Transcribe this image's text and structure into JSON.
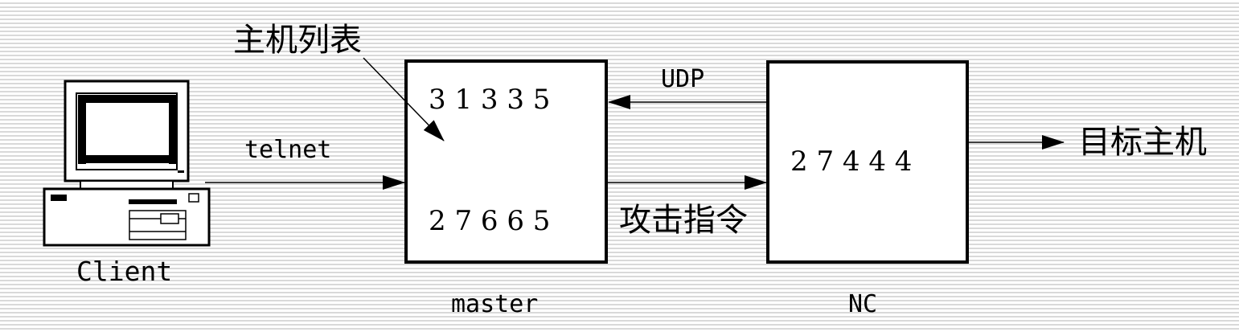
{
  "client": {
    "label": "Client"
  },
  "master": {
    "label": "master",
    "top_number": "3 1 3 3 5",
    "bottom_number": "2 7 6 6 5",
    "host_list_label": "主机列表"
  },
  "nc": {
    "label": "NC",
    "number": "2 7 4 4 4"
  },
  "arrows": {
    "telnet": "telnet",
    "udp": "UDP",
    "attack": "攻击指令",
    "target": "目标主机"
  }
}
